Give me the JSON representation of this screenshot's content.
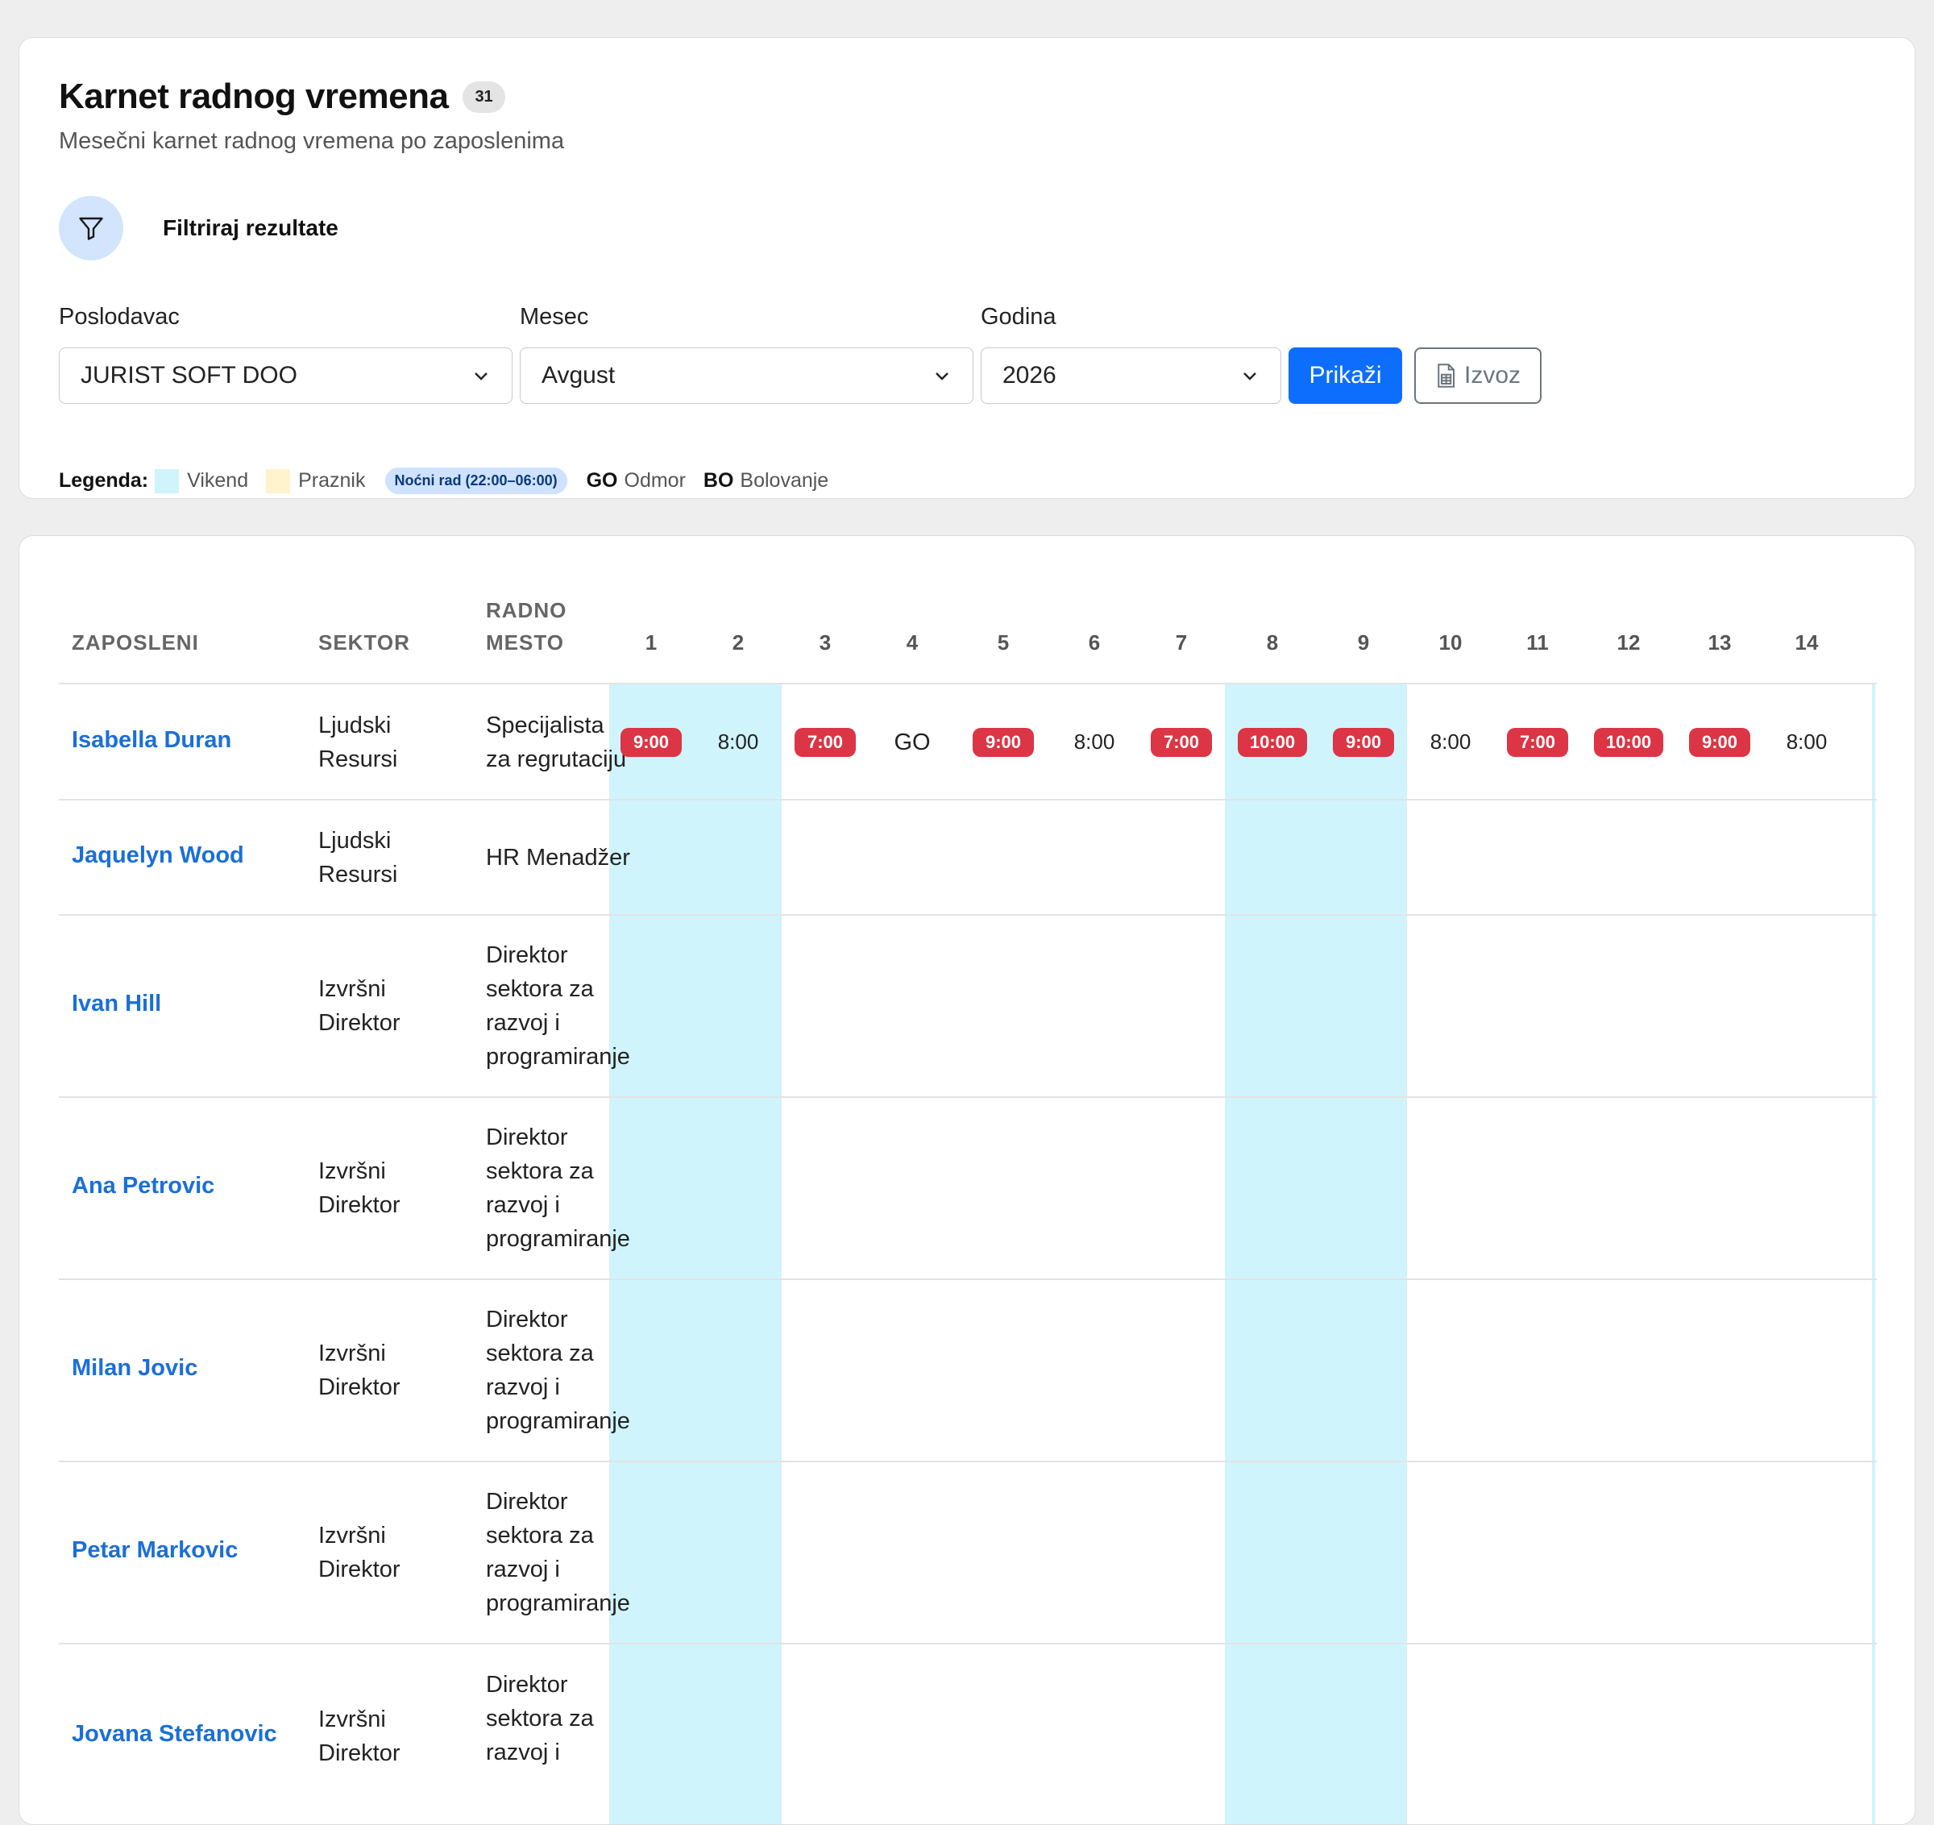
{
  "header": {
    "title": "Karnet radnog vremena",
    "count": "31",
    "subtitle": "Mesečni karnet radnog vremena po zaposlenima"
  },
  "filters": {
    "heading": "Filtriraj rezultate",
    "employer_label": "Poslodavac",
    "employer_value": "JURIST SOFT DOO",
    "month_label": "Mesec",
    "month_value": "Avgust",
    "year_label": "Godina",
    "year_value": "2026",
    "show_button": "Prikaži",
    "export_button": "Izvoz"
  },
  "legend": {
    "title": "Legenda:",
    "weekend": "Vikend",
    "holiday": "Praznik",
    "night": "Noćni rad (22:00–06:00)",
    "go_code": "GO",
    "go_label": "Odmor",
    "bo_code": "BO",
    "bo_label": "Bolovanje"
  },
  "colors": {
    "primary": "#0d6efd",
    "weekend": "#cff4fc",
    "holiday": "#fff3cd",
    "night_hours": "#dc3545",
    "name_link": "#1a6fd8"
  },
  "table": {
    "col_employee": "ZAPOSLENI",
    "col_sector": "SEKTOR",
    "col_position_1": "RADNO",
    "col_position_2": "MESTO",
    "days": [
      "1",
      "2",
      "3",
      "4",
      "5",
      "6",
      "7",
      "8",
      "9",
      "10",
      "11",
      "12",
      "13",
      "14"
    ],
    "weekend_days": [
      "1",
      "2",
      "8",
      "9"
    ],
    "rows": [
      {
        "name": "Isabella Duran",
        "sector": [
          "Ljudski",
          "Resursi"
        ],
        "position": [
          "Specijalista",
          "za regrutaciju"
        ],
        "hours": [
          {
            "v": "9:00",
            "night": true
          },
          {
            "v": "8:00",
            "night": false
          },
          {
            "v": "7:00",
            "night": true
          },
          {
            "v": "GO",
            "night": false
          },
          {
            "v": "9:00",
            "night": true
          },
          {
            "v": "8:00",
            "night": false
          },
          {
            "v": "7:00",
            "night": true
          },
          {
            "v": "10:00",
            "night": true
          },
          {
            "v": "9:00",
            "night": true
          },
          {
            "v": "8:00",
            "night": false
          },
          {
            "v": "7:00",
            "night": true
          },
          {
            "v": "10:00",
            "night": true
          },
          {
            "v": "9:00",
            "night": true
          },
          {
            "v": "8:00",
            "night": false
          }
        ]
      },
      {
        "name": "Jaquelyn Wood",
        "sector": [
          "Ljudski",
          "Resursi"
        ],
        "position": [
          "HR Menadžer"
        ]
      },
      {
        "name": "Ivan Hill",
        "sector": [
          "Izvršni",
          "Direktor"
        ],
        "position": [
          "Direktor",
          "sektora za",
          "razvoj i",
          "programiranje"
        ]
      },
      {
        "name": "Ana Petrovic",
        "sector": [
          "Izvršni",
          "Direktor"
        ],
        "position": [
          "Direktor",
          "sektora za",
          "razvoj i",
          "programiranje"
        ]
      },
      {
        "name": "Milan Jovic",
        "sector": [
          "Izvršni",
          "Direktor"
        ],
        "position": [
          "Direktor",
          "sektora za",
          "razvoj i",
          "programiranje"
        ]
      },
      {
        "name": "Petar Markovic",
        "sector": [
          "Izvršni",
          "Direktor"
        ],
        "position": [
          "Direktor",
          "sektora za",
          "razvoj i",
          "programiranje"
        ]
      },
      {
        "name": "Jovana Stefanovic",
        "sector": [
          "Izvršni",
          "Direktor"
        ],
        "position": [
          "Direktor",
          "sektora za",
          "razvoj i"
        ]
      }
    ]
  }
}
